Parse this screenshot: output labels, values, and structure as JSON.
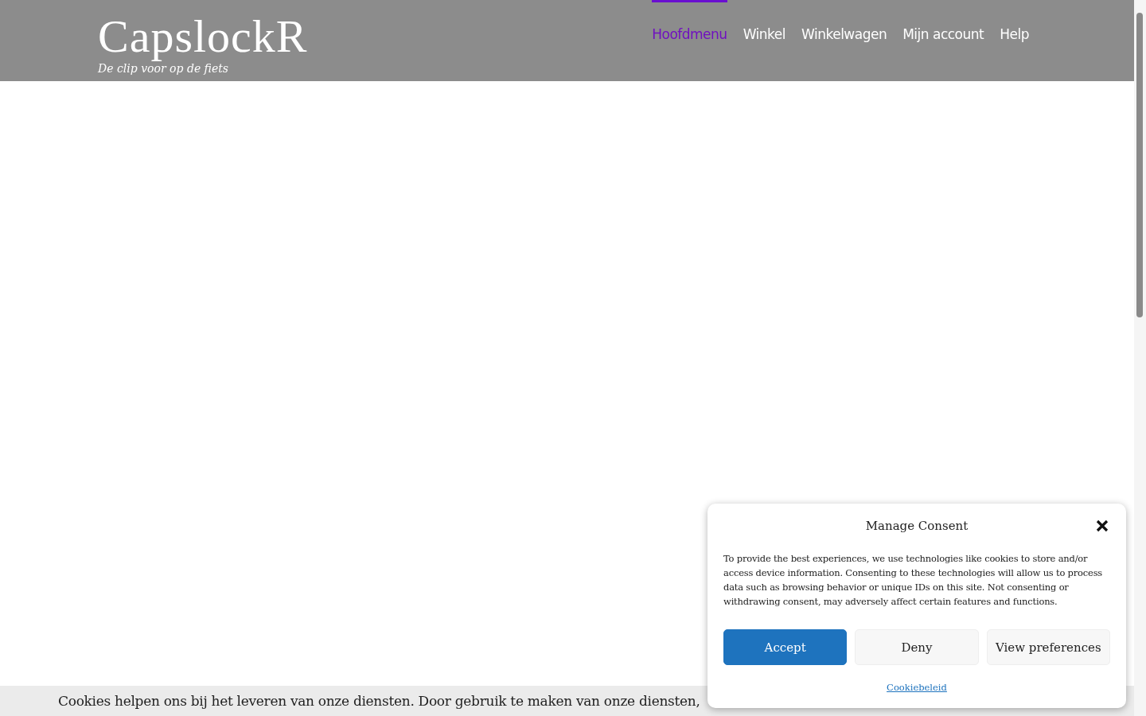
{
  "site": {
    "title": "CapslockR",
    "tagline": "De clip voor op de fiets"
  },
  "nav": [
    {
      "label": "Hoofdmenu",
      "selected": true
    },
    {
      "label": "Winkel",
      "selected": false
    },
    {
      "label": "Winkelwagen",
      "selected": false
    },
    {
      "label": "Mijn account",
      "selected": false
    },
    {
      "label": "Help",
      "selected": false
    }
  ],
  "cookie_bar": {
    "text": "Cookies helpen ons bij het leveren van onze diensten. Door gebruik te maken van onze diensten,"
  },
  "consent_dialog": {
    "title": "Manage Consent",
    "body": "To provide the best experiences, we use technologies like cookies to store and/or access device information. Consenting to these technologies will allow us to process data such as browsing behavior or unique IDs on this site. Not consenting or withdrawing consent, may adversely affect certain features and functions.",
    "buttons": [
      {
        "label": "Accept",
        "kind": "primary"
      },
      {
        "label": "Deny",
        "kind": "secondary"
      },
      {
        "label": "View preferences",
        "kind": "secondary"
      }
    ],
    "link": "Cookiebeleid"
  }
}
